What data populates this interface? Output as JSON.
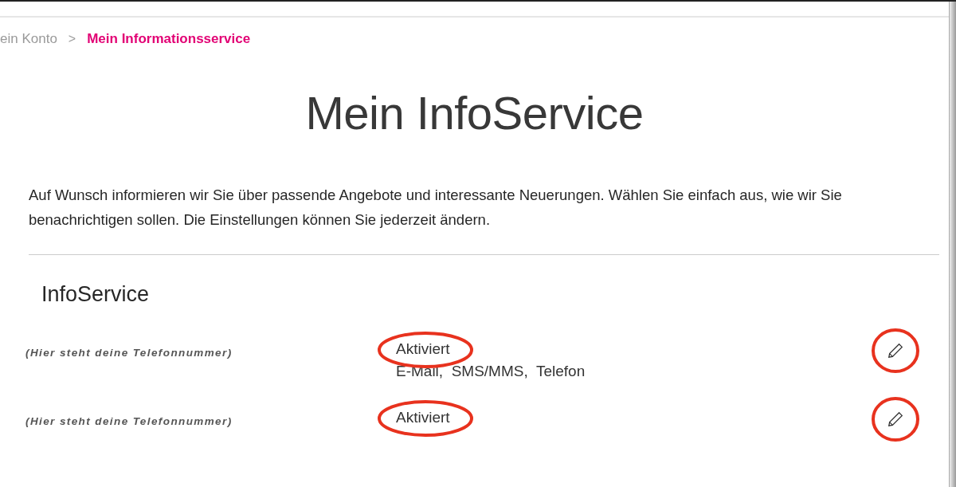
{
  "breadcrumb": [
    {
      "label": "ein Konto",
      "selected": false
    },
    {
      "label": "Mein Informationsservice",
      "selected": true
    }
  ],
  "breadcrumb_separator": ">",
  "title": "Mein InfoService",
  "intro": "Auf Wunsch informieren wir Sie über passende Angebote und interessante Neuerungen. Wählen Sie einfach aus, wie wir Sie benachrichtigen sollen. Die Einstellungen können Sie jederzeit ändern.",
  "section_title": "InfoService",
  "rows": [
    {
      "phone": "(Hier steht deine Telefonnummer)",
      "status": "Aktiviert",
      "channels": "E-Mail,  SMS/MMS,  Telefon",
      "circled": true
    },
    {
      "phone": "(Hier steht deine Telefonnummer)",
      "status": "Aktiviert",
      "circled": true
    }
  ]
}
